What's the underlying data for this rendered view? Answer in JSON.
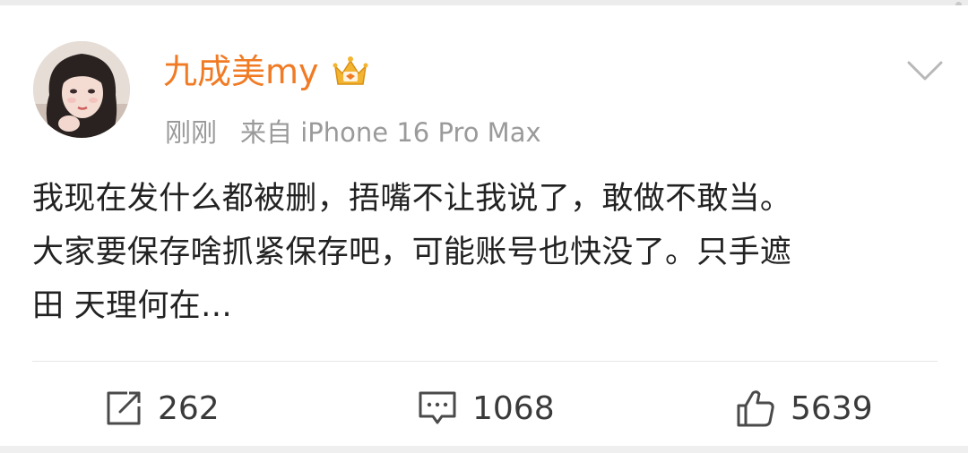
{
  "post": {
    "author": {
      "name": "九成美my",
      "badge_icon": "crown-badge-icon"
    },
    "time": "刚刚",
    "source": "来自 iPhone 16 Pro Max",
    "text_lines": [
      "我现在发什么都被删，捂嘴不让我说了，敢做不敢当。",
      "大家要保存啥抓紧保存吧，可能账号也快没了。只手遮",
      "田 天理何在…"
    ]
  },
  "actions": {
    "repost": {
      "icon": "repost-icon",
      "count": "262"
    },
    "comment": {
      "icon": "comment-icon",
      "count": "1068"
    },
    "like": {
      "icon": "thumbs-up-icon",
      "count": "5639"
    }
  },
  "colors": {
    "username": "#f07b24",
    "meta": "#9a9a9a",
    "text": "#222222",
    "badge_gold": "#f3b531"
  }
}
